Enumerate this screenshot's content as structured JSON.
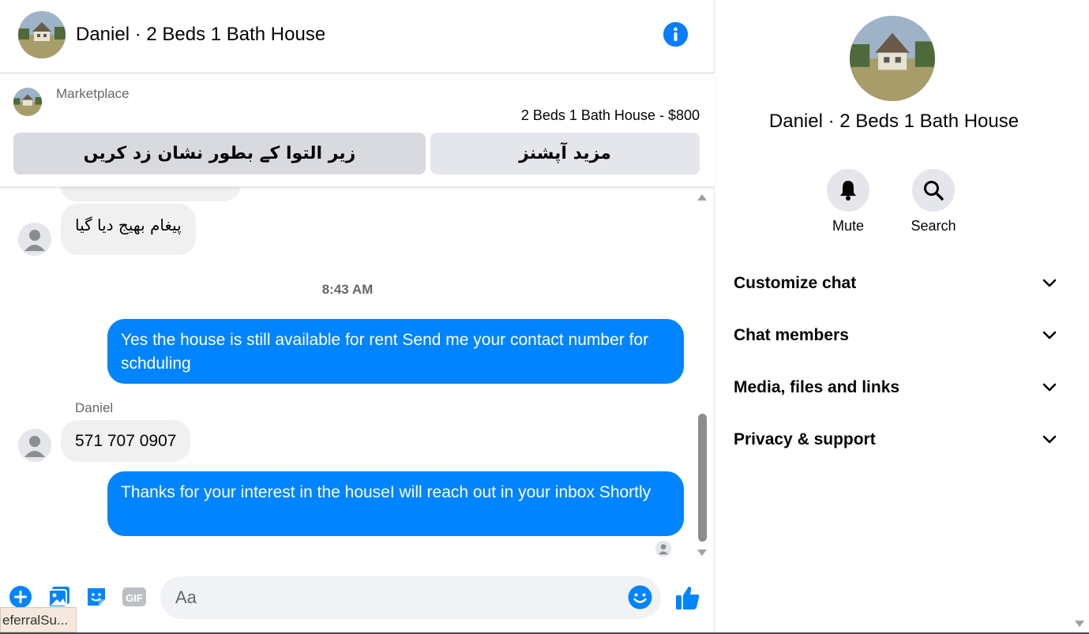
{
  "header": {
    "title": "Daniel · 2 Beds 1 Bath House",
    "info_icon": "info-icon"
  },
  "marketplace": {
    "label": "Marketplace",
    "listing": "2 Beds 1 Bath House - $800",
    "mark_pending_label": "زیر التوا کے بطور نشان زد کریں",
    "more_options_label": "مزید آپشنز"
  },
  "messages": {
    "first_incoming": "پیغام بھیج دیا گیا",
    "timestamp": "8:43 AM",
    "outgoing_1": "Yes the house is still available for rent Send me your contact number for schduling",
    "sender_name": "Daniel",
    "incoming_phone": "571 707 0907",
    "outgoing_2": "Thanks for your interest in the houseI will reach out  in your inbox Shortly"
  },
  "composer": {
    "placeholder": "Aa",
    "icons": [
      "plus-icon",
      "photo-icon",
      "sticker-icon",
      "gif-icon",
      "emoji-icon",
      "thumbs-up-icon"
    ]
  },
  "status_tooltip": "eferralSu...",
  "info_panel": {
    "title": "Daniel · 2 Beds 1 Bath House",
    "mute_label": "Mute",
    "search_label": "Search",
    "sections": [
      "Customize chat",
      "Chat members",
      "Media, files and links",
      "Privacy & support"
    ]
  },
  "colors": {
    "accent": "#0084ff",
    "incoming_bubble": "#f0f0f0",
    "button_gray": "#e4e6eb"
  }
}
